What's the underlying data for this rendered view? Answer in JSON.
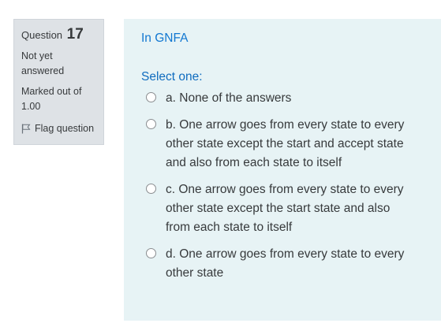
{
  "question_info": {
    "label": "Question",
    "number": "17",
    "state": "Not yet answered",
    "grade": "Marked out of 1.00",
    "flag_label": "Flag question"
  },
  "question": {
    "text": "In GNFA",
    "prompt": "Select one:",
    "options": [
      {
        "letter": "a.",
        "text": "None of the answers"
      },
      {
        "letter": "b.",
        "text": "One arrow goes from every state to every other state except the start and accept state and also from each state to itself"
      },
      {
        "letter": "c.",
        "text": "One arrow goes from every state to every other state except the start state and also from each state to itself"
      },
      {
        "letter": "d.",
        "text": "One arrow goes from every state to every other state"
      }
    ]
  },
  "icons": {
    "flag": "flag-outline-icon"
  },
  "colors": {
    "info_bg": "#dee2e6",
    "content_bg": "#e7f3f5",
    "link_blue": "#1177d1"
  }
}
